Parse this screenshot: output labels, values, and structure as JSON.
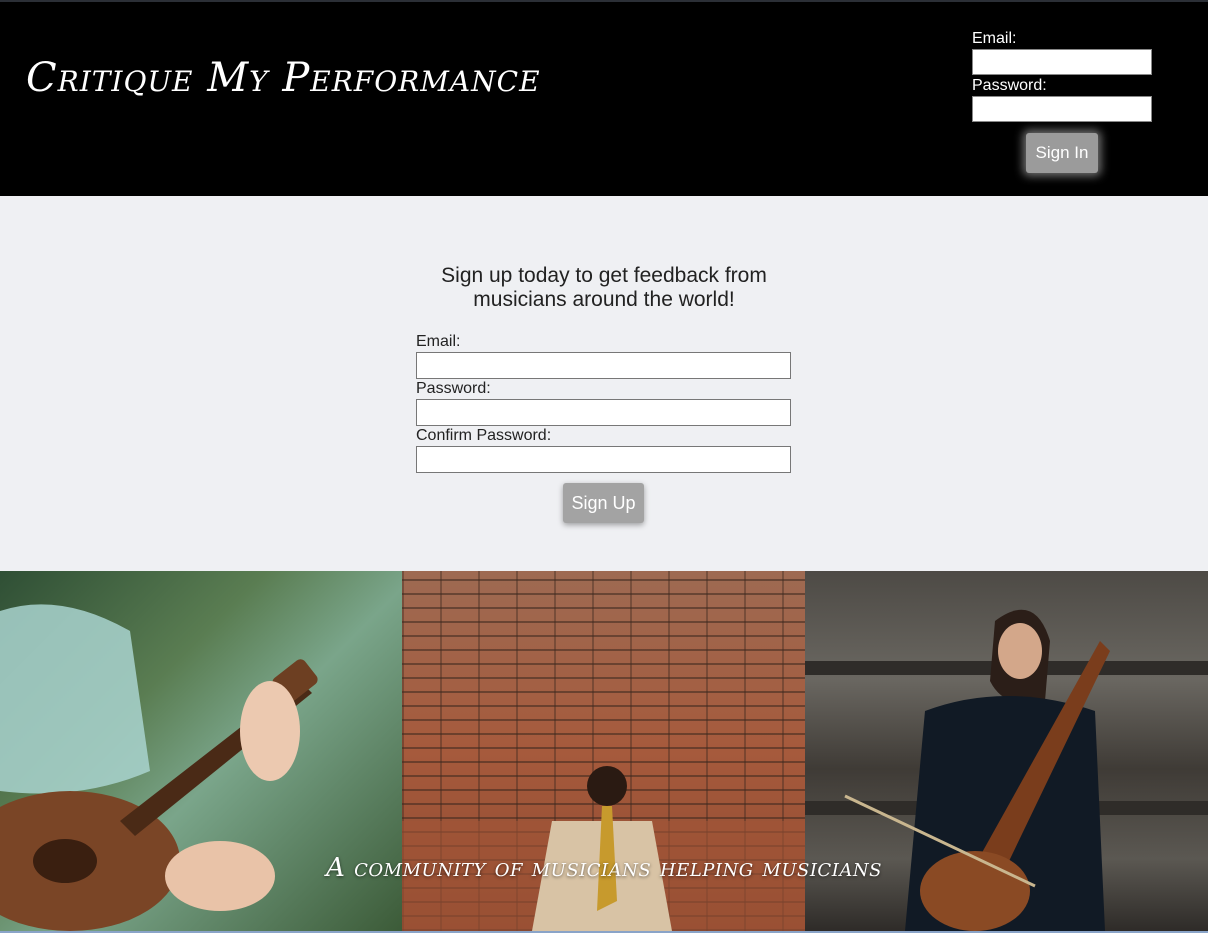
{
  "header": {
    "title": "Critique My Performance",
    "signin": {
      "email_label": "Email:",
      "password_label": "Password:",
      "button_label": "Sign In"
    }
  },
  "signup": {
    "heading": "Sign up today to get feedback from musicians around the world!",
    "email_label": "Email:",
    "password_label": "Password:",
    "confirm_label": "Confirm Password:",
    "button_label": "Sign Up"
  },
  "hero": {
    "tagline": "A community of musicians helping musicians"
  },
  "colors": {
    "header_bg": "#000000",
    "page_bg": "#eff0f3",
    "button_bg": "#9b9b9b"
  }
}
